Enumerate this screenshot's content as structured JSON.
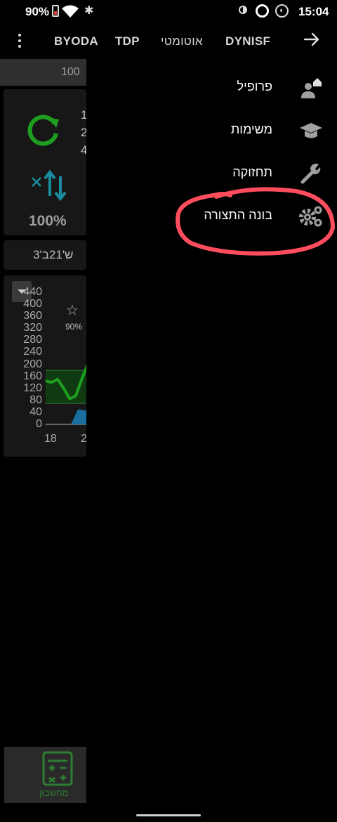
{
  "status_bar": {
    "battery_percent": "90%",
    "time": "15:04",
    "icons": [
      "battery-low-icon",
      "wifi-icon",
      "bluetooth-icon",
      "contrast-icon",
      "ring-icon",
      "brand-icon"
    ]
  },
  "top_bar": {
    "tabs": [
      "BYODA",
      "TDP",
      "אוטומטי",
      "DYNISF"
    ],
    "menu_icon": "more-vert-icon",
    "back_icon": "arrow-right-icon"
  },
  "background_app": {
    "header_value": "100",
    "card1_lines": [
      "1",
      "2",
      "4"
    ],
    "percent": "100%",
    "age_text": "ש'21ב'3",
    "chart_star_percent": "90%"
  },
  "chart_data": {
    "type": "line",
    "ylim": [
      0,
      440
    ],
    "yticks": [
      "440",
      "400",
      "360",
      "320",
      "280",
      "240",
      "200",
      "160",
      "120",
      "80",
      "40",
      "0"
    ],
    "xticks": [
      "18",
      "2"
    ],
    "series": [
      {
        "color": "#1e9e1e",
        "values": [
          145,
          140,
          150,
          120,
          85,
          95,
          150,
          200
        ]
      }
    ]
  },
  "drawer": {
    "items": [
      {
        "label": "פרופיל",
        "icon": "profile-icon"
      },
      {
        "label": "משימות",
        "icon": "graduation-cap-icon"
      },
      {
        "label": "תחזוקה",
        "icon": "wrench-icon"
      },
      {
        "label": "בונה התצורה",
        "icon": "gears-icon"
      }
    ]
  },
  "bottom": {
    "calc_label": "מחשבון",
    "calc_icon": "calculator-icon"
  },
  "colors": {
    "background": "#000000",
    "accent_green": "#1e9e1e",
    "accent_teal": "#1a8ca0",
    "annotation_red": "#ff4d5e"
  }
}
